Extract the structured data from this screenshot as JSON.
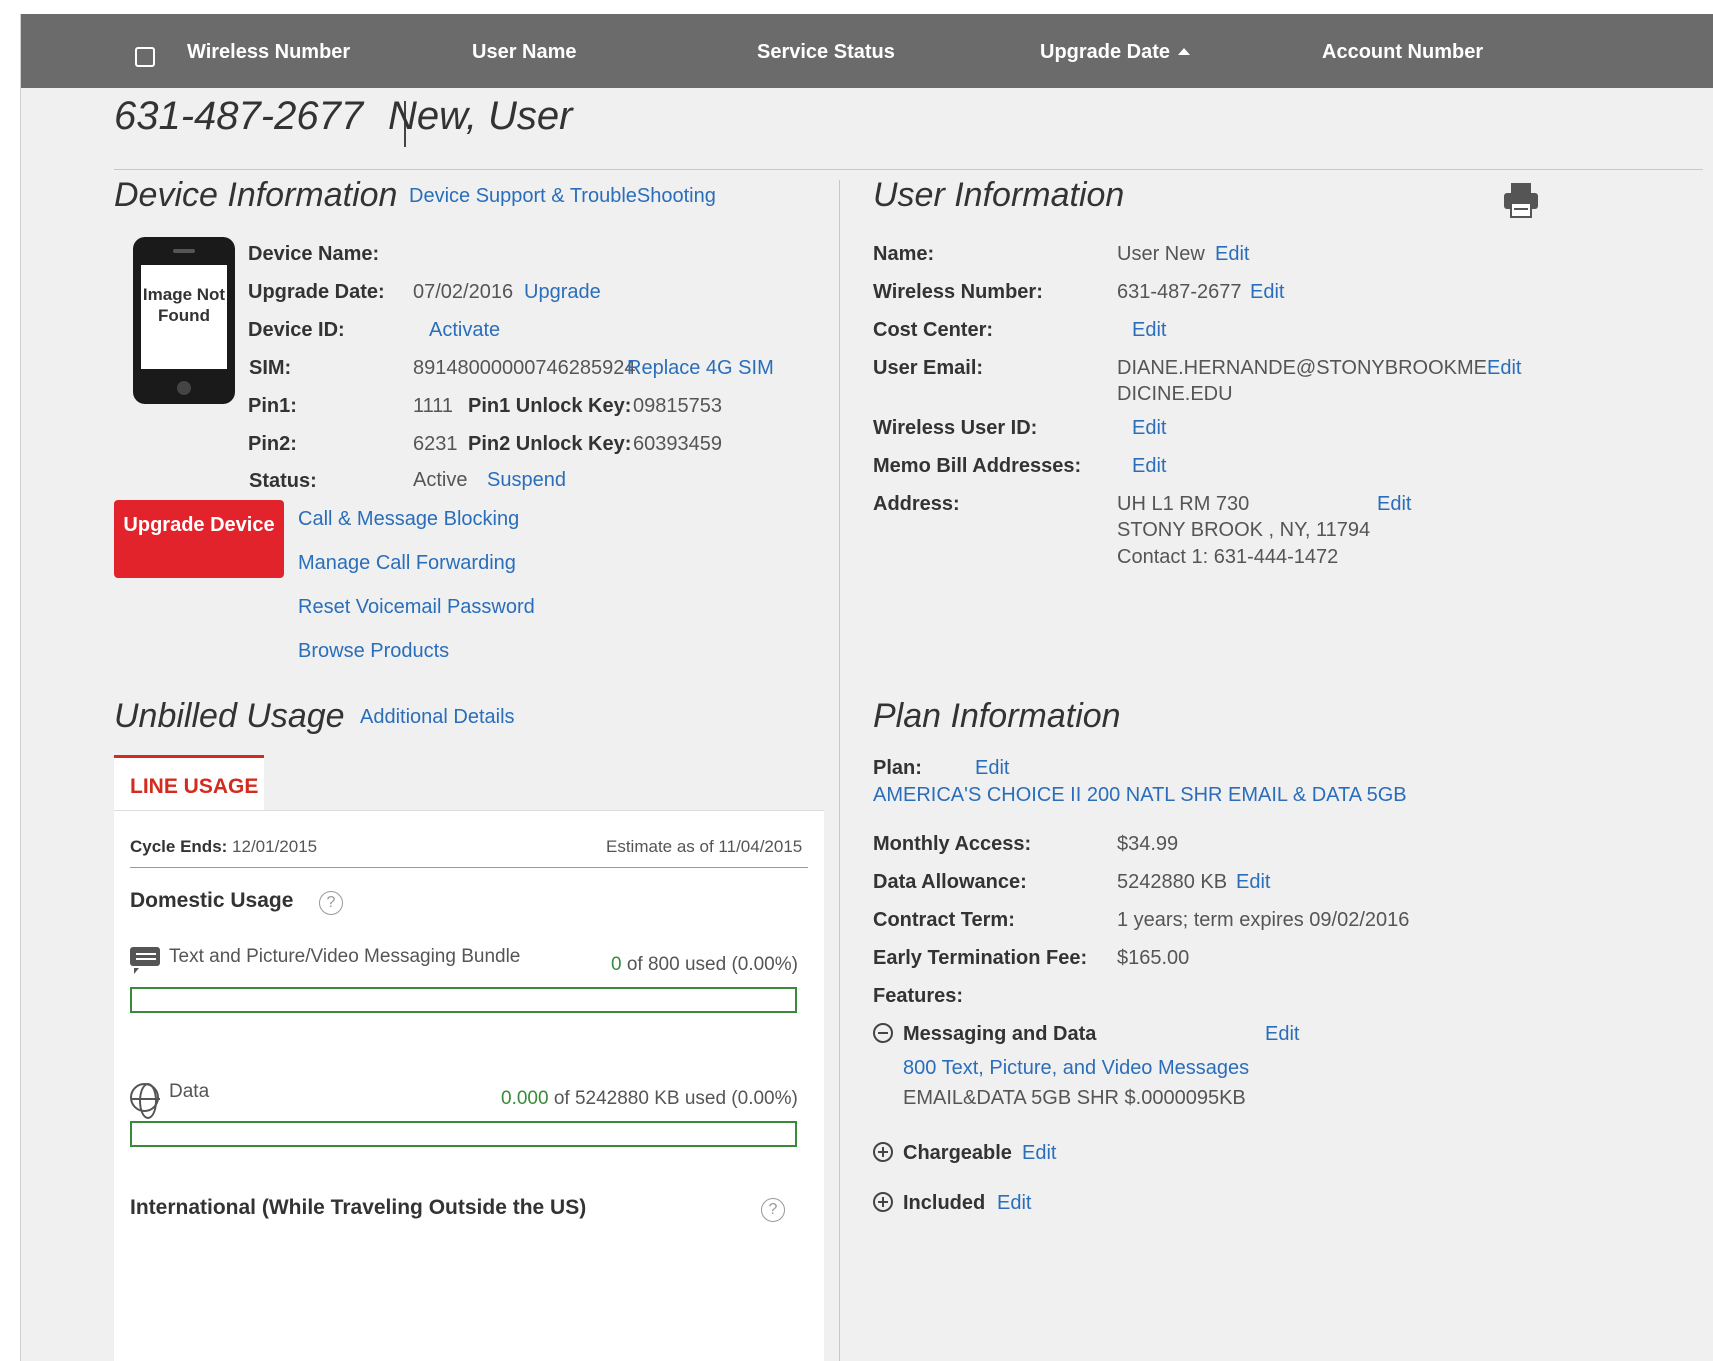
{
  "header": {
    "columns": [
      "Wireless Number",
      "User Name",
      "Service Status",
      "Upgrade Date",
      "Account Number"
    ]
  },
  "title": {
    "number": "631-487-2677",
    "name": "New, User"
  },
  "device": {
    "heading": "Device Information",
    "support_link": "Device Support & TroubleShooting",
    "image_text": "Image Not Found",
    "name_label": "Device Name:",
    "upgrade_date_label": "Upgrade Date:",
    "upgrade_date": "07/02/2016",
    "upgrade_link": "Upgrade",
    "device_id_label": "Device ID:",
    "activate_link": "Activate",
    "sim_label": "SIM:",
    "sim": "89148000000746285924",
    "replace_sim_link": "Replace 4G SIM",
    "pin1_label": "Pin1:",
    "pin1": "1111",
    "pin1_unlock_label": "Pin1 Unlock Key:",
    "pin1_unlock": "09815753",
    "pin2_label": "Pin2:",
    "pin2": "6231",
    "pin2_unlock_label": "Pin2 Unlock Key:",
    "pin2_unlock": "60393459",
    "status_label": "Status:",
    "status": "Active",
    "suspend_link": "Suspend",
    "upgrade_button": "Upgrade Device",
    "actions": [
      "Call & Message Blocking",
      "Manage Call Forwarding",
      "Reset Voicemail Password",
      "Browse Products"
    ]
  },
  "usage": {
    "heading": "Unbilled Usage",
    "details_link": "Additional Details",
    "tab": "LINE USAGE",
    "cycle_label": "Cycle Ends:",
    "cycle_date": "12/01/2015",
    "estimate": "Estimate as of 11/04/2015",
    "domestic_heading": "Domestic Usage",
    "help": "?",
    "messaging": {
      "label": "Text and Picture/Video Messaging Bundle",
      "used": "0",
      "rest": "of 800 used (0.00%)",
      "fraction": 0
    },
    "data": {
      "label": "Data",
      "used": "0.000",
      "rest": "of 5242880 KB used (0.00%)",
      "fraction": 0
    },
    "international_heading": "International (While Traveling Outside the US)"
  },
  "user": {
    "heading": "User Information",
    "edit": "Edit",
    "name_label": "Name:",
    "name": "User New",
    "wireless_label": "Wireless Number:",
    "wireless": "631-487-2677",
    "cost_center_label": "Cost Center:",
    "email_label": "User Email:",
    "email_line1": "DIANE.HERNANDE@STONYBROOKME",
    "email_line2": "DICINE.EDU",
    "wireless_user_id_label": "Wireless User ID:",
    "memo_label": "Memo Bill Addresses:",
    "address_label": "Address:",
    "address_line1": "UH L1 RM 730",
    "address_line2": "STONY BROOK , NY, 11794",
    "address_line3": "Contact 1: 631-444-1472"
  },
  "plan": {
    "heading": "Plan Information",
    "plan_label": "Plan:",
    "plan_name": "AMERICA'S CHOICE II 200 NATL SHR EMAIL & DATA 5GB",
    "monthly_label": "Monthly Access:",
    "monthly": "$34.99",
    "data_label": "Data Allowance:",
    "data": "5242880 KB",
    "contract_label": "Contract Term:",
    "contract": "1 years; term expires 09/02/2016",
    "etf_label": "Early Termination Fee:",
    "etf": "$165.00",
    "features_label": "Features:",
    "messaging_group": "Messaging and Data",
    "messaging_link": "800 Text, Picture, and Video Messages",
    "messaging_item": "EMAIL&DATA 5GB SHR $.0000095KB",
    "chargeable": "Chargeable",
    "included": "Included"
  }
}
